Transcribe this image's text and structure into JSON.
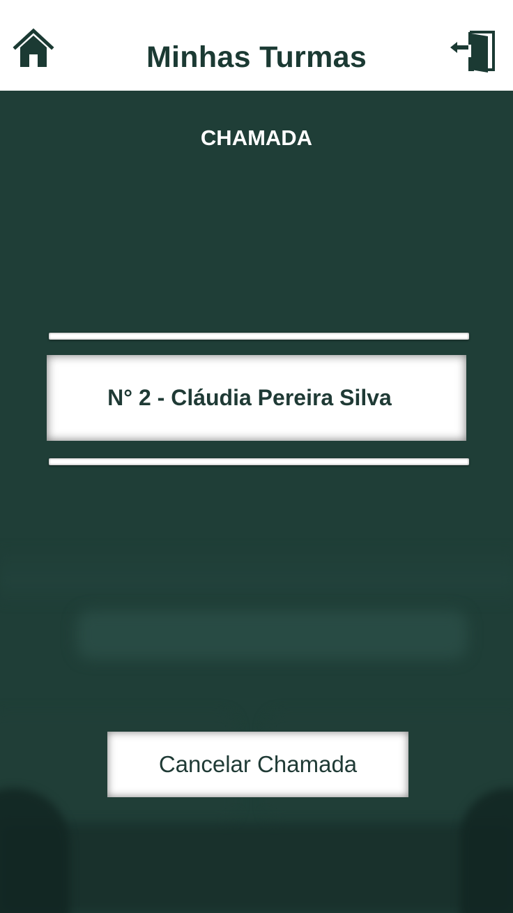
{
  "header": {
    "title": "Minhas Turmas",
    "home_icon": "home-icon",
    "logout_icon": "logout-door-icon"
  },
  "section": {
    "title": "CHAMADA"
  },
  "current_student": {
    "label": "N° 2 - Cláudia Pereira Silva"
  },
  "actions": {
    "cancel_label": "Cancelar Chamada"
  },
  "colors": {
    "primary_dark_green": "#1b3a33",
    "background_green": "#1f3e37",
    "white": "#ffffff"
  }
}
